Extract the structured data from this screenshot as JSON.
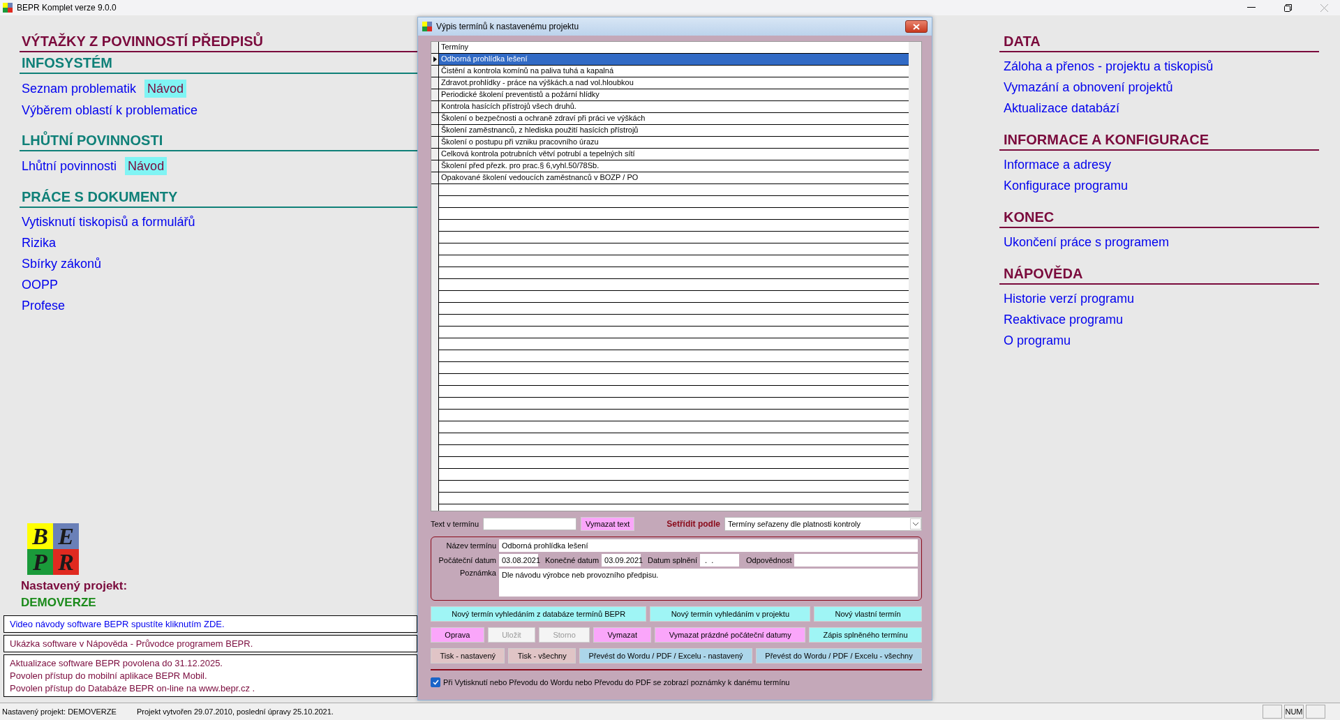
{
  "window": {
    "title": "BEPR Komplet verze 9.0.0"
  },
  "left": {
    "sections": [
      {
        "title": "VÝTAŽKY Z POVINNOSTÍ PŘEDPISŮ",
        "kind": "main"
      },
      {
        "title": "INFOSYSTÉM",
        "kind": "sub",
        "items": [
          {
            "label": "Seznam problematik",
            "guide": "Návod"
          },
          {
            "label": "Výběrem oblastí k problematice"
          }
        ]
      },
      {
        "title": "LHŮTNÍ POVINNOSTI",
        "kind": "sub",
        "items": [
          {
            "label": "Lhůtní povinnosti",
            "guide": "Návod"
          }
        ]
      },
      {
        "title": "PRÁCE S DOKUMENTY",
        "kind": "sub",
        "items": [
          {
            "label": "Vytisknutí tiskopisů a formulářů"
          },
          {
            "label": "Rizika"
          },
          {
            "label": "Sbírky zákonů"
          },
          {
            "label": "OOPP"
          },
          {
            "label": "Profese"
          }
        ]
      }
    ]
  },
  "project": {
    "logo": [
      "B",
      "E",
      "P",
      "R"
    ],
    "label": "Nastavený projekt:",
    "name": "DEMOVERZE"
  },
  "notices": [
    {
      "kind": "link",
      "lines": [
        "Video návody software BEPR spustíte kliknutím ZDE."
      ]
    },
    {
      "kind": "info",
      "lines": [
        "Ukázka software v Nápověda - Průvodce programem BEPR."
      ]
    },
    {
      "kind": "info",
      "lines": [
        "Aktualizace software BEPR povolena do 31.12.2025.",
        "Povolen přístup do mobilní aplikace BEPR Mobil.",
        "Povolen přístup do Databáze BEPR on-line na www.bepr.cz ."
      ]
    }
  ],
  "right": {
    "sections": [
      {
        "title": "DATA",
        "items": [
          {
            "label": "Záloha a přenos - projektu a tiskopisů"
          },
          {
            "label": "Vymazání a obnovení projektů"
          },
          {
            "label": "Aktualizace databází"
          }
        ]
      },
      {
        "title": "INFORMACE A KONFIGURACE",
        "items": [
          {
            "label": "Informace a adresy"
          },
          {
            "label": "Konfigurace programu"
          }
        ]
      },
      {
        "title": "KONEC",
        "items": [
          {
            "label": "Ukončení práce s programem"
          }
        ]
      },
      {
        "title": "NÁPOVĚDA",
        "items": [
          {
            "label": "Historie verzí programu"
          },
          {
            "label": "Reaktivace programu"
          },
          {
            "label": "O programu"
          }
        ]
      }
    ]
  },
  "dialog": {
    "title": "Výpis termínů k nastavenému projektu",
    "grid": {
      "column": "Termíny",
      "rows": [
        {
          "text": "Odborná prohlídka lešení",
          "selected": true
        },
        {
          "text": "Čistění a kontrola komínů na paliva tuhá a kapalná",
          "selected": false
        },
        {
          "text": "Zdravot.prohlídky - práce na výškách.a nad vol.hloubkou",
          "selected": false
        },
        {
          "text": "Periodické školení preventistů a požární hlídky",
          "selected": false
        },
        {
          "text": "Kontrola hasících přístrojů všech druhů.",
          "selected": false
        },
        {
          "text": "Školení o bezpečnosti a ochraně zdraví při práci ve výškách",
          "selected": false
        },
        {
          "text": "Školení zaměstnanců, z hlediska použití hasících přístrojů",
          "selected": false
        },
        {
          "text": "Školení o postupu při vzniku pracovního úrazu",
          "selected": false
        },
        {
          "text": "Celková kontrola potrubních větví potrubí a tepelných sítí",
          "selected": false
        },
        {
          "text": "Školení před přezk. pro prac.§ 6,vyhl.50/78Sb.",
          "selected": false
        },
        {
          "text": "Opakované školení vedoucích zaměstnanců v BOZP / PO",
          "selected": false
        }
      ]
    },
    "search": {
      "label": "Text v termínu",
      "clear": "Vymazat text"
    },
    "sort": {
      "label": "Setřídit podle",
      "value": "Termíny seřazeny dle platnosti kontroly"
    },
    "detail": {
      "name": {
        "label": "Název termínu",
        "value": "Odborná prohlídka lešení"
      },
      "dates": [
        {
          "label": "Počáteční datum",
          "value": "03.08.2021"
        },
        {
          "label": "Konečné datum",
          "value": "03.09.2021"
        },
        {
          "label": "Datum splnění",
          "value": " .  ."
        },
        {
          "label": "Odpovědnost"
        }
      ],
      "note": {
        "label": "Poznámka",
        "value": "Dle návodu výrobce neb provozního předpisu."
      }
    },
    "button_rows": [
      [
        {
          "label": "Nový termín vyhledáním z databáze termínů BEPR",
          "kind": "create",
          "disabled": false
        },
        {
          "label": "Nový termín vyhledáním v projektu",
          "kind": "create",
          "disabled": false
        },
        {
          "label": "Nový vlastní termín",
          "kind": "create",
          "disabled": false
        }
      ],
      [
        {
          "label": "Oprava",
          "kind": "modify",
          "disabled": false
        },
        {
          "label": "Uložit",
          "disabled": true
        },
        {
          "label": "Storno",
          "disabled": true
        },
        {
          "label": "Vymazat",
          "kind": "modify",
          "disabled": false
        },
        {
          "label": "Vymazat prázdné počáteční datumy",
          "kind": "modify",
          "disabled": false
        },
        {
          "label": "Zápis splněného termínu",
          "kind": "create",
          "disabled": false
        }
      ],
      [
        {
          "label": "Tisk - nastavený",
          "kind": "print",
          "disabled": false
        },
        {
          "label": "Tisk - všechny",
          "kind": "print",
          "disabled": false
        },
        {
          "label": "Převést do Wordu / PDF / Excelu - nastavený",
          "kind": "export",
          "disabled": false
        },
        {
          "label": "Převést do Wordu / PDF / Excelu - všechny",
          "kind": "export",
          "disabled": false
        }
      ]
    ],
    "checkbox": {
      "label": "Při Vytisknutí nebo Převodu do Wordu nebo Převodu do PDF se zobrazí poznámky k danému termínu",
      "checked": true
    }
  },
  "status_bar": {
    "texts": [
      "Nastavený projekt: DEMOVERZE",
      "Projekt vytvořen 29.07.2010, poslední úpravy 25.10.2021."
    ],
    "panels": [
      {
        "kind": "blank"
      },
      {
        "kind": "text",
        "text": "NUM"
      },
      {
        "kind": "blank"
      }
    ]
  }
}
